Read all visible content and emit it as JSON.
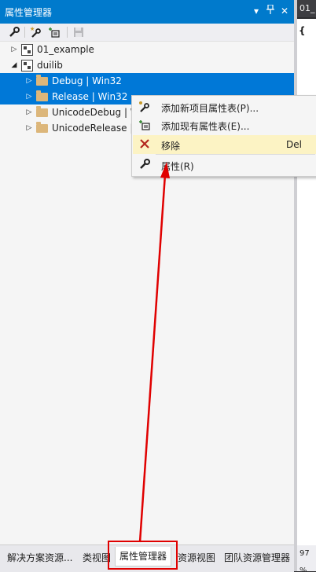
{
  "panel": {
    "title": "属性管理器",
    "title_buttons": {
      "dropdown": "▾",
      "pin": "ꟸ",
      "close": "✕"
    }
  },
  "toolbar": {
    "buttons": [
      {
        "name": "properties-icon"
      },
      {
        "name": "add-new-property-sheet-icon"
      },
      {
        "name": "add-existing-property-sheet-icon"
      },
      {
        "name": "save-icon"
      }
    ]
  },
  "tree": {
    "items": [
      {
        "label": "01_example",
        "expanded": false,
        "level": 0,
        "kind": "project",
        "selected": false
      },
      {
        "label": "duilib",
        "expanded": true,
        "level": 0,
        "kind": "project",
        "selected": false
      },
      {
        "label": "Debug | Win32",
        "expanded": false,
        "level": 1,
        "kind": "config",
        "selected": true
      },
      {
        "label": "Release | Win32",
        "expanded": false,
        "level": 1,
        "kind": "config",
        "selected": true
      },
      {
        "label": "UnicodeDebug | W",
        "expanded": false,
        "level": 1,
        "kind": "config",
        "selected": false
      },
      {
        "label": "UnicodeRelease |",
        "expanded": false,
        "level": 1,
        "kind": "config",
        "selected": false
      }
    ]
  },
  "context_menu": {
    "items": [
      {
        "label": "添加新项目属性表(P)...",
        "shortcut": "",
        "icon": "add-new-property-sheet-icon",
        "highlighted": false
      },
      {
        "label": "添加现有属性表(E)...",
        "shortcut": "",
        "icon": "add-existing-property-sheet-icon",
        "highlighted": false
      },
      {
        "label": "移除",
        "shortcut": "Del",
        "icon": "remove-icon",
        "highlighted": true
      },
      {
        "label": "属性(R)",
        "shortcut": "",
        "icon": "wrench-icon",
        "highlighted": false
      }
    ]
  },
  "bottom_tabs": [
    {
      "label": "解决方案资源...",
      "active": false
    },
    {
      "label": "类视图",
      "active": false
    },
    {
      "label": "属性管理器",
      "active": true
    },
    {
      "label": "资源视图",
      "active": false
    },
    {
      "label": "团队资源管理器",
      "active": false
    }
  ],
  "right_doc": {
    "tab_label": "01_",
    "brace_glyph": "{",
    "zoom": "97 %"
  },
  "colors": {
    "title_bar": "#007acc",
    "selection": "#0078d7",
    "menu_highlight": "#fcf3c4",
    "annotation": "#e00000"
  }
}
